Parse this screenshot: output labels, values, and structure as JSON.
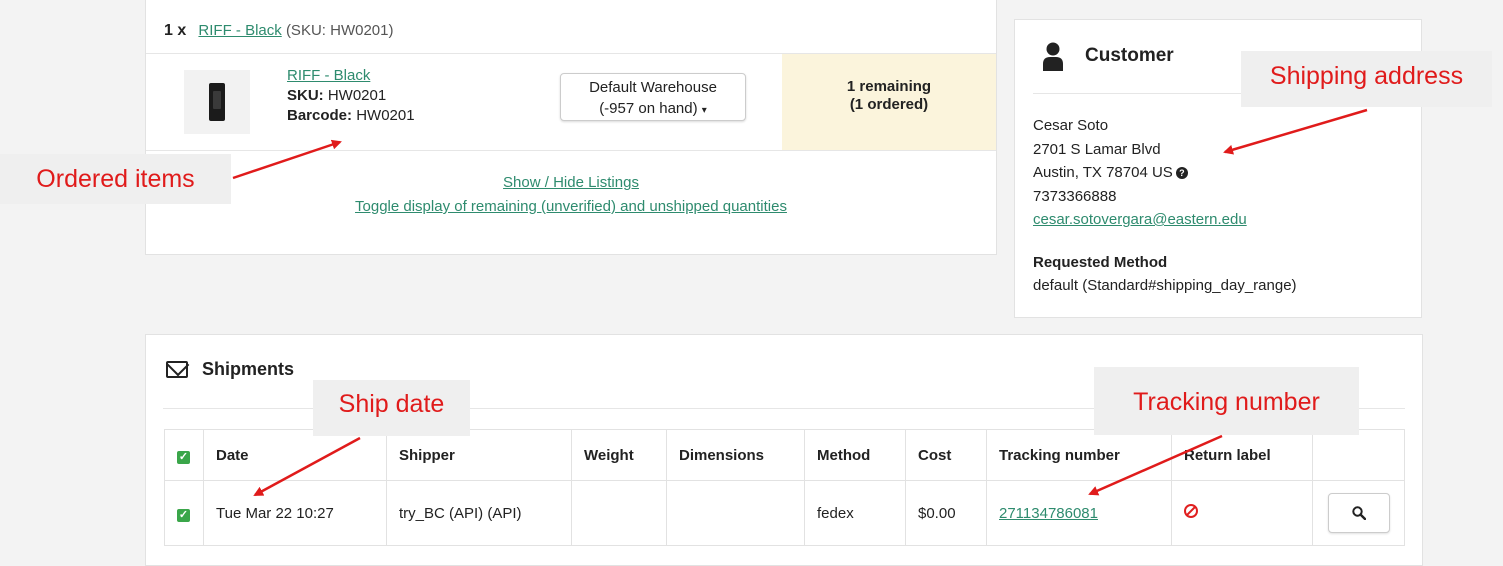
{
  "order": {
    "line_qty": "1 x",
    "line_item_link": "RIFF - Black",
    "line_sku": "(SKU: HW0201)",
    "item_link": "RIFF - Black",
    "sku_label": "SKU:",
    "sku_value": "HW0201",
    "barcode_label": "Barcode:",
    "barcode_value": "HW0201",
    "warehouse_line1": "Default Warehouse",
    "warehouse_line2": "(-957 on hand)",
    "remaining_line1": "1 remaining",
    "remaining_line2": "(1 ordered)",
    "show_hide_listings": "Show / Hide Listings",
    "toggle_display": "Toggle display of remaining (unverified) and unshipped quantities"
  },
  "customer": {
    "title": "Customer",
    "name": "Cesar Soto",
    "address1": "2701 S Lamar Blvd",
    "address2": "Austin, TX 78704 US",
    "phone": "7373366888",
    "email": "cesar.sotovergara@eastern.edu",
    "requested_method_label": "Requested Method",
    "requested_method_value": "default (Standard#shipping_day_range)"
  },
  "shipments": {
    "title": "Shipments",
    "columns": [
      "Date",
      "Shipper",
      "Weight",
      "Dimensions",
      "Method",
      "Cost",
      "Tracking number",
      "Return label"
    ],
    "rows": [
      {
        "date": "Tue Mar 22 10:27",
        "shipper": "try_BC (API) (API)",
        "weight": "",
        "dimensions": "",
        "method": "fedex",
        "cost": "$0.00",
        "tracking": "271134786081"
      }
    ]
  },
  "callouts": {
    "ordered_items": "Ordered items",
    "shipping_address": "Shipping address",
    "ship_date": "Ship date",
    "tracking_number": "Tracking number"
  },
  "colors": {
    "link": "#2e8b6e",
    "remaining_bg": "#fbf4dc",
    "callout_text": "#e01b1b",
    "checkbox": "#3aa64a"
  }
}
